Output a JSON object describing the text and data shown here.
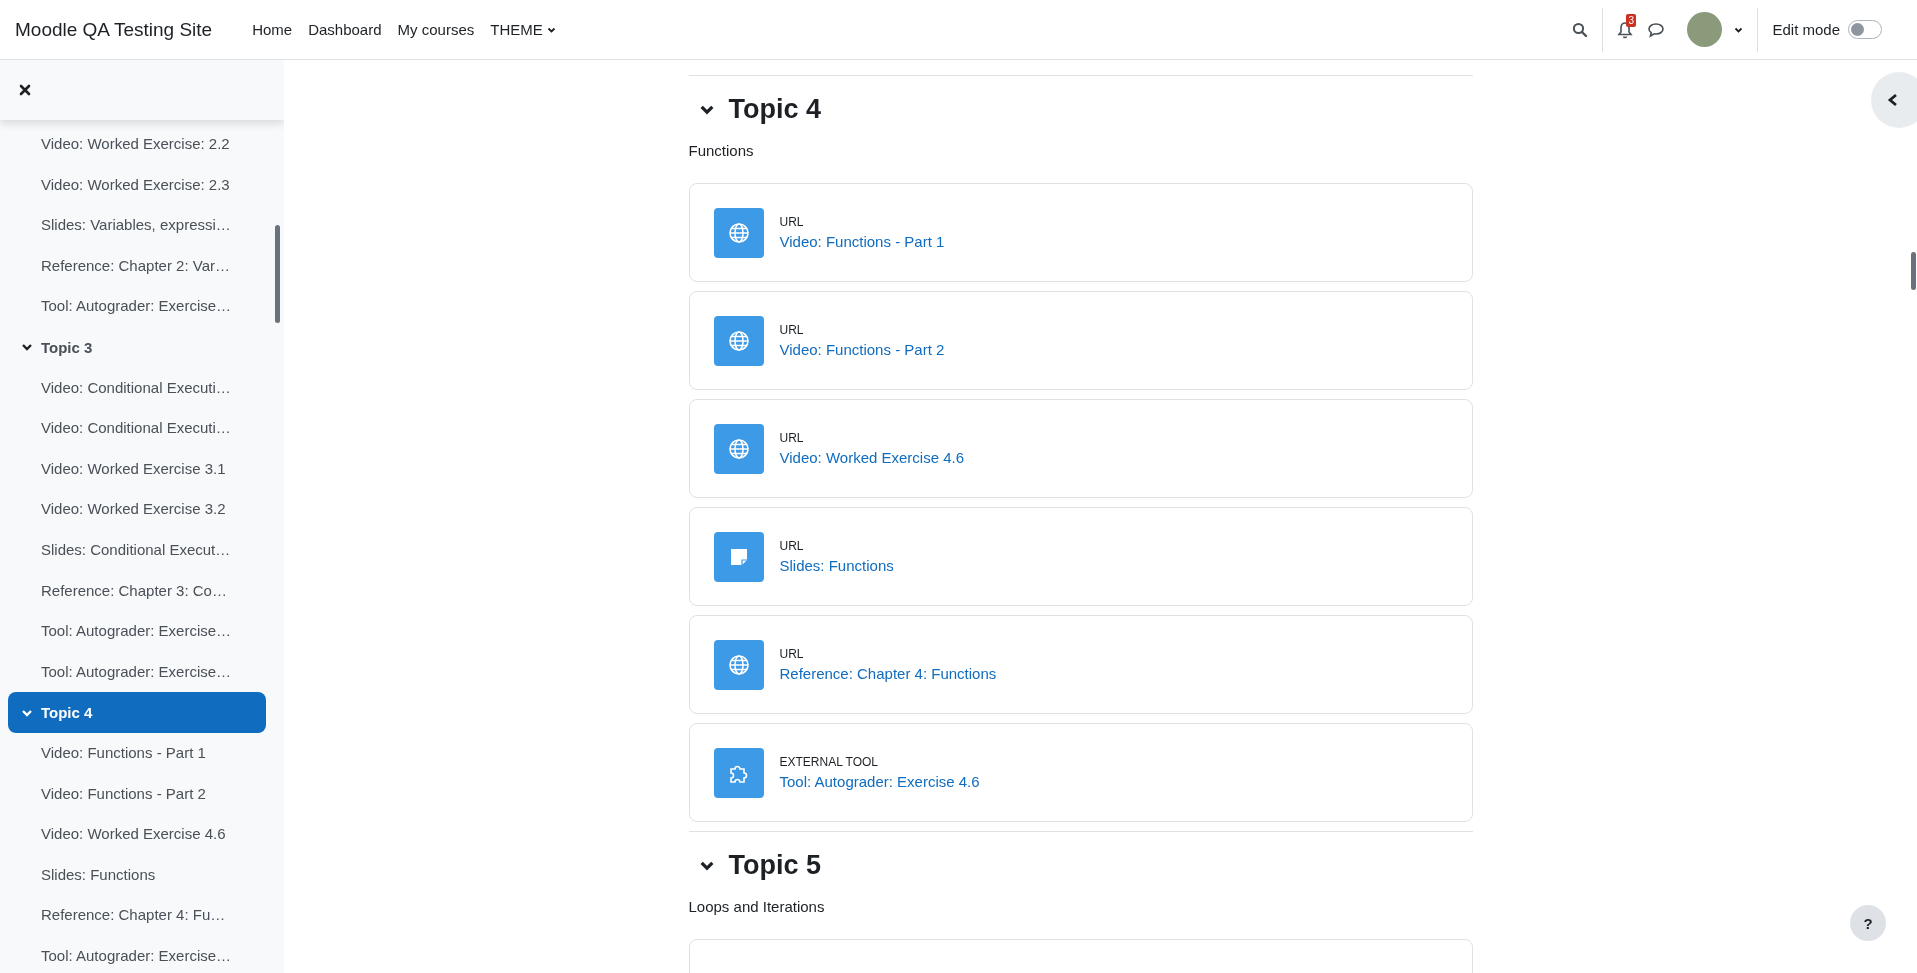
{
  "navbar": {
    "brand": "Moodle QA Testing Site",
    "links": [
      {
        "label": "Home",
        "has_menu": false
      },
      {
        "label": "Dashboard",
        "has_menu": false
      },
      {
        "label": "My courses",
        "has_menu": false
      },
      {
        "label": "THEME",
        "has_menu": true
      }
    ],
    "notification_count": "3",
    "edit_mode": {
      "label": "Edit mode",
      "on": false
    }
  },
  "course_index": {
    "items": [
      {
        "kind": "activity",
        "label": "Video: Worked Exercise: 2.2"
      },
      {
        "kind": "activity",
        "label": "Video: Worked Exercise: 2.3"
      },
      {
        "kind": "activity",
        "label": "Slides: Variables, expressi…"
      },
      {
        "kind": "activity",
        "label": "Reference: Chapter 2: Var…"
      },
      {
        "kind": "activity",
        "label": "Tool: Autograder: Exercise…"
      },
      {
        "kind": "section",
        "label": "Topic 3",
        "expanded": true,
        "selected": false,
        "children": [
          {
            "kind": "activity",
            "label": "Video: Conditional Executi…"
          },
          {
            "kind": "activity",
            "label": "Video: Conditional Executi…"
          },
          {
            "kind": "activity",
            "label": "Video: Worked Exercise 3.1"
          },
          {
            "kind": "activity",
            "label": "Video: Worked Exercise 3.2"
          },
          {
            "kind": "activity",
            "label": "Slides: Conditional Execut…"
          },
          {
            "kind": "activity",
            "label": "Reference: Chapter 3: Co…"
          },
          {
            "kind": "activity",
            "label": "Tool: Autograder: Exercise…"
          },
          {
            "kind": "activity",
            "label": "Tool: Autograder: Exercise…"
          }
        ]
      },
      {
        "kind": "section",
        "label": "Topic 4",
        "expanded": true,
        "selected": true,
        "children": [
          {
            "kind": "activity",
            "label": "Video: Functions - Part 1"
          },
          {
            "kind": "activity",
            "label": "Video: Functions - Part 2"
          },
          {
            "kind": "activity",
            "label": "Video: Worked Exercise 4.6"
          },
          {
            "kind": "activity",
            "label": "Slides: Functions"
          },
          {
            "kind": "activity",
            "label": "Reference: Chapter 4: Fu…"
          },
          {
            "kind": "activity",
            "label": "Tool: Autograder: Exercise…"
          }
        ]
      }
    ]
  },
  "sections": [
    {
      "title": "Topic 4",
      "expanded": true,
      "summary": "Functions",
      "activities": [
        {
          "kind": "link",
          "type": "URL",
          "name": "Video: Functions - Part 1"
        },
        {
          "kind": "link",
          "type": "URL",
          "name": "Video: Functions - Part 2"
        },
        {
          "kind": "link",
          "type": "URL",
          "name": "Video: Worked Exercise 4.6"
        },
        {
          "kind": "file",
          "type": "URL",
          "name": "Slides: Functions"
        },
        {
          "kind": "link",
          "type": "URL",
          "name": "Reference: Chapter 4: Functions"
        },
        {
          "kind": "tool",
          "type": "EXTERNAL TOOL",
          "name": "Tool: Autograder: Exercise 4.6"
        }
      ]
    },
    {
      "title": "Topic 5",
      "expanded": true,
      "summary": "Loops and Iterations",
      "activities": [
        {
          "kind": "blank"
        }
      ]
    }
  ],
  "help_button": "?"
}
